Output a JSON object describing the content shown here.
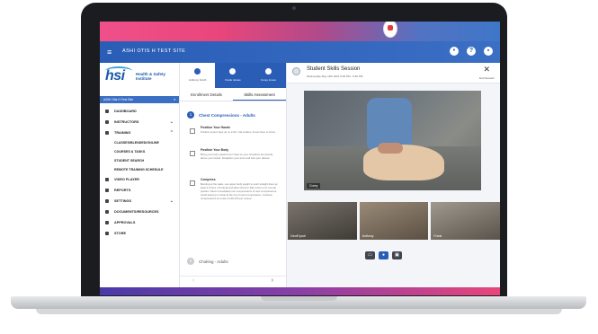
{
  "app": {
    "site_name": "ASHI OTIS H TEST SITE",
    "brand": {
      "mark": "hsi",
      "line1": "Health & Safety",
      "line2": "Institute"
    },
    "site_selector": "ASHI Otis H Test Site"
  },
  "colors": {
    "accent": "#2a5db6",
    "top_gradient_start": "#f0508a",
    "top_gradient_end": "#3f76c8"
  },
  "sidebar": {
    "items": [
      {
        "label": "DASHBOARD",
        "icon": "dashboard-icon"
      },
      {
        "label": "INSTRUCTORS",
        "icon": "instructors-icon",
        "expandable": true
      },
      {
        "label": "TRAINING",
        "icon": "training-icon",
        "expandable": true
      },
      {
        "label": "VIDEO PLAYER",
        "icon": "video-icon"
      },
      {
        "label": "REPORTS",
        "icon": "reports-icon"
      },
      {
        "label": "SETTINGS",
        "icon": "settings-icon",
        "expandable": true
      },
      {
        "label": "DOCUMENTS/RESOURCES",
        "icon": "documents-icon"
      },
      {
        "label": "APPROVALS",
        "icon": "approvals-icon"
      },
      {
        "label": "STORE",
        "icon": "store-icon"
      }
    ],
    "training_sub": [
      "CLASSES/BLENDED/ONLINE",
      "COURSES & TASKS",
      "STUDENT SEARCH",
      "REMOTE TRAINING SCHEDULE"
    ]
  },
  "participants": [
    "Anthony Smith",
    "Frank James",
    "Corey Jones"
  ],
  "tabs": [
    "Enrollment Details",
    "Skills Assessment"
  ],
  "assessment": {
    "section1": {
      "number": "1",
      "title": "Chest Compressions - Adults"
    },
    "steps": [
      {
        "title": "Position Your Hands",
        "desc": "Position person face up on a firm, flat surface. Kneel close to chest."
      },
      {
        "title": "Position Your Body",
        "desc": "Bring your body upward over chest so your shoulders are directly above your hands. Straighten your arms and lock your elbows."
      },
      {
        "title": "Compress",
        "desc": "Bending at the waist, use upper body weight to push straight down at least 2 inches. Lift hands and allow chest to fully return to its normal position. Move immediately into compressions of next compressions. Avoid leaning on chest at the top of each compression. Continue compressions at a rate of 100-120 per minute."
      }
    ],
    "section2": {
      "number": "2",
      "title": "Choking - Adults"
    }
  },
  "session": {
    "title": "Student Skills Session",
    "subtitle": "Wednesday May 12th 2021 5:00 PM - 5:30 PM",
    "end_label": "End Session",
    "close": "✕"
  },
  "video": {
    "main_label": "Corey",
    "thumbs": [
      "Geoff Ipoel",
      "Anthony",
      "Frank"
    ]
  },
  "controls": [
    "cam",
    "mic",
    "share"
  ]
}
